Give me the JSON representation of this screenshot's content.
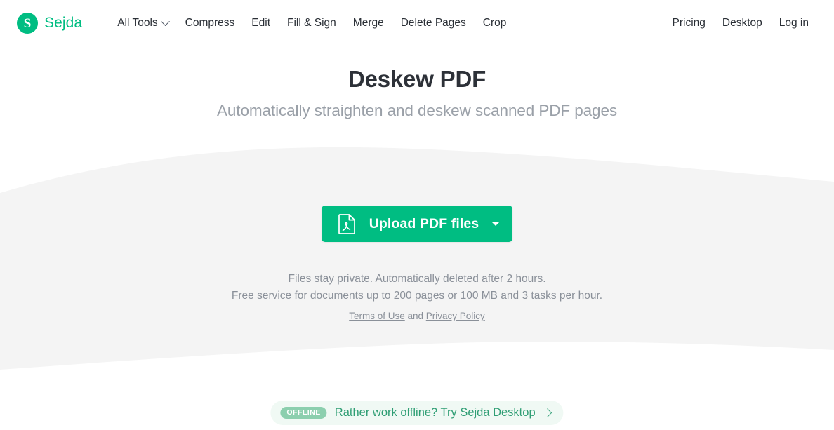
{
  "brand": {
    "mark_letter": "S",
    "name": "Sejda",
    "accent_color": "#00bd82"
  },
  "header": {
    "nav_main": [
      {
        "label": "All Tools",
        "has_caret": true
      },
      {
        "label": "Compress",
        "has_caret": false
      },
      {
        "label": "Edit",
        "has_caret": false
      },
      {
        "label": "Fill & Sign",
        "has_caret": false
      },
      {
        "label": "Merge",
        "has_caret": false
      },
      {
        "label": "Delete Pages",
        "has_caret": false
      },
      {
        "label": "Crop",
        "has_caret": false
      }
    ],
    "nav_right": [
      {
        "label": "Pricing"
      },
      {
        "label": "Desktop"
      },
      {
        "label": "Log in"
      }
    ]
  },
  "hero": {
    "title": "Deskew PDF",
    "subtitle": "Automatically straighten and deskew scanned PDF pages"
  },
  "upload": {
    "icon": "pdf-file-icon",
    "button_label": "Upload PDF files",
    "dropdown_icon": "caret-down-icon",
    "button_color": "#00bd82"
  },
  "notes": {
    "line1": "Files stay private. Automatically deleted after 2 hours.",
    "line2": "Free service for documents up to 200 pages or 100 MB and 3 tasks per hour.",
    "legal_terms": "Terms of Use",
    "legal_conjunction": " and ",
    "legal_privacy": "Privacy Policy"
  },
  "offline_banner": {
    "badge": "OFFLINE",
    "label": "Rather work offline? Try Sejda Desktop",
    "chevron_icon": "chevron-right-icon",
    "background_color": "#f0f9f4",
    "text_color": "#2f9e74"
  },
  "background": {
    "band_color": "#f4f4f4"
  }
}
